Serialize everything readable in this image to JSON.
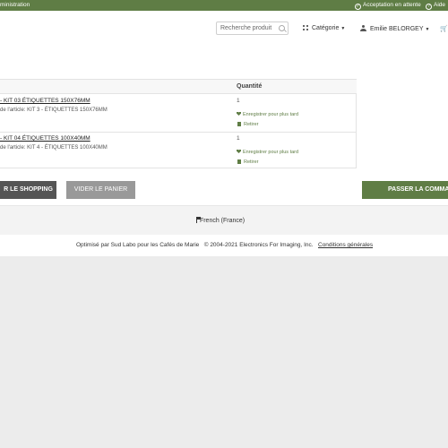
{
  "topbar": {
    "admin_label": "ministration",
    "status_label": "Acceptation en attente",
    "help_label": "Aide"
  },
  "header": {
    "search_placeholder": "Recherche produit",
    "category_label": "Catégorie",
    "user_label": "Emilie BELORGEY"
  },
  "cart": {
    "quantity_header": "Quantité",
    "items": [
      {
        "name": "- KIT 03 ÉTIQUETTES 150X76MM",
        "description": "de l'article: KIT 3 - ÉTIQUETTES 150X76MM",
        "quantity": "1",
        "save_label": "Enregistrer pour plus tard",
        "remove_label": "Retirer"
      },
      {
        "name": "- KIT 04 ÉTIQUETTES 100X40MM",
        "description": "de l'article: KIT 4 - ÉTIQUETTES 100X40MM",
        "quantity": "1",
        "save_label": "Enregistrer pour plus tard",
        "remove_label": "Retirer"
      }
    ],
    "continue_label": "R LE SHOPPING",
    "empty_label": "VIDER LE PANIER",
    "order_label": "PASSER LA COMMA"
  },
  "footer": {
    "language": "French (France)",
    "credit": "Optimisé par Sud Labo pour les Cafés de Marie",
    "copyright": "© 2004-2021 Electronics For Imaging, Inc.",
    "terms": "Conditions générales"
  },
  "colors": {
    "accent": "#5f7d45",
    "dark_button": "#555555",
    "grey_button": "#999999"
  }
}
